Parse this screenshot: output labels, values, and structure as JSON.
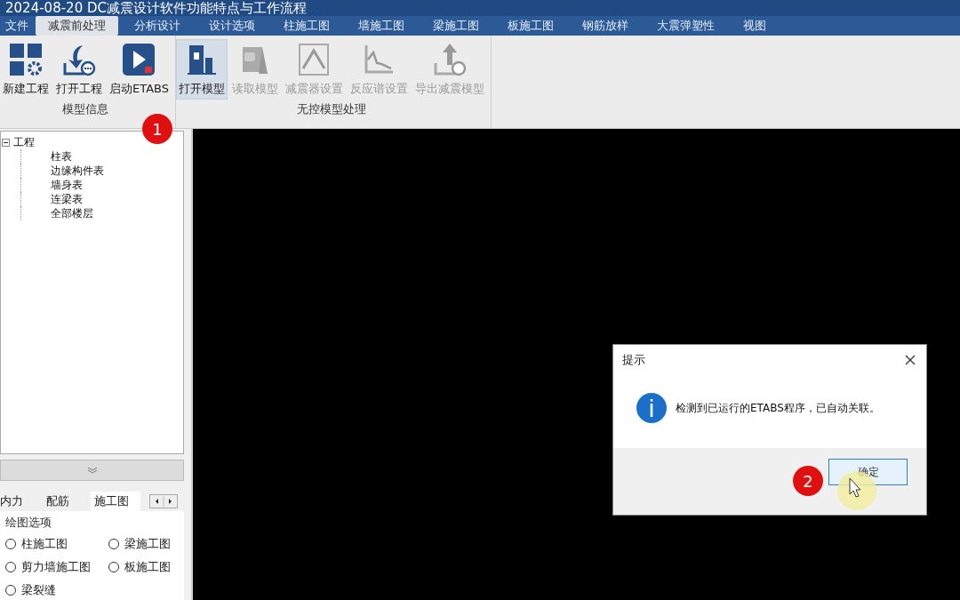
{
  "window": {
    "title": "2024-08-20 DC减震设计软件功能特点与工作流程"
  },
  "menu": [
    {
      "label": "文件",
      "selected": false
    },
    {
      "label": "减震前处理",
      "selected": true
    },
    {
      "label": "分析设计",
      "selected": false
    },
    {
      "label": "设计选项",
      "selected": false
    },
    {
      "label": "柱施工图",
      "selected": false
    },
    {
      "label": "墙施工图",
      "selected": false
    },
    {
      "label": "梁施工图",
      "selected": false
    },
    {
      "label": "板施工图",
      "selected": false
    },
    {
      "label": "钢筋放样",
      "selected": false
    },
    {
      "label": "大震弹塑性",
      "selected": false
    },
    {
      "label": "视图",
      "selected": false
    }
  ],
  "ribbon": [
    {
      "label": "模型信息",
      "buttons": [
        {
          "label": "新建工程",
          "kind": "grid",
          "disabled": false,
          "selected": false
        },
        {
          "label": "打开工程",
          "kind": "open",
          "disabled": false,
          "selected": false
        },
        {
          "label": "启动ETABS",
          "kind": "play",
          "disabled": false,
          "selected": false
        }
      ]
    },
    {
      "label": "无控模型处理",
      "buttons": [
        {
          "label": "打开模型",
          "kind": "building",
          "disabled": false,
          "selected": true
        },
        {
          "label": "读取模型",
          "kind": "read",
          "disabled": true,
          "selected": false
        },
        {
          "label": "减震器设置",
          "kind": "damper",
          "disabled": true,
          "selected": false
        },
        {
          "label": "反应谱设置",
          "kind": "spectrum",
          "disabled": true,
          "selected": false
        },
        {
          "label": "导出减震模型",
          "kind": "export",
          "disabled": true,
          "selected": false
        }
      ]
    }
  ],
  "tree": {
    "label": "工程",
    "expanded": true,
    "children": [
      {
        "label": "柱表"
      },
      {
        "label": "边缘构件表"
      },
      {
        "label": "墙身表"
      },
      {
        "label": "连梁表"
      },
      {
        "label": "全部楼层"
      }
    ]
  },
  "panel_tabs": [
    {
      "label": "内力",
      "selected": false
    },
    {
      "label": "配筋",
      "selected": false
    },
    {
      "label": "施工图",
      "selected": true
    }
  ],
  "options_group": {
    "title": "绘图选项",
    "options": [
      {
        "label": "柱施工图",
        "selected": false
      },
      {
        "label": "梁施工图",
        "selected": false
      },
      {
        "label": "剪力墙施工图",
        "selected": false
      },
      {
        "label": "板施工图",
        "selected": false
      },
      {
        "label": "梁裂缝",
        "selected": false
      }
    ]
  },
  "dialog": {
    "title": "提示",
    "message": "检测到已运行的ETABS程序，已自动关联。",
    "button": "确定"
  },
  "callouts": [
    {
      "label": "1"
    },
    {
      "label": "2"
    }
  ]
}
